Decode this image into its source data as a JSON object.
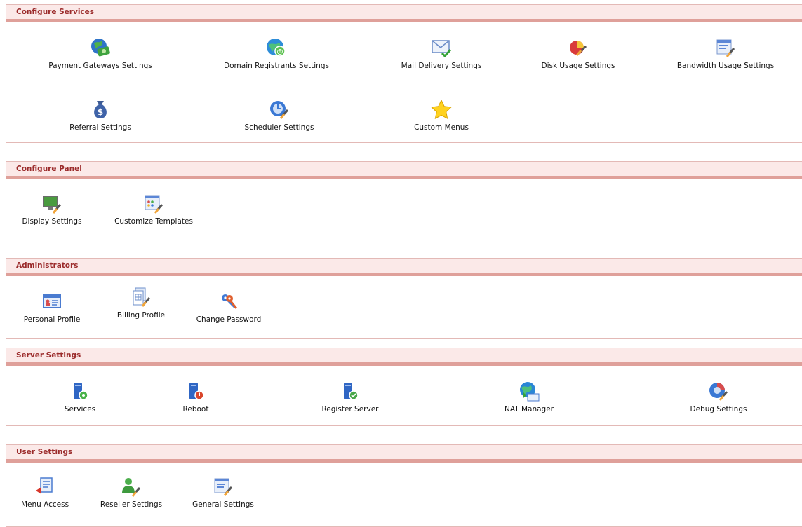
{
  "sections": [
    {
      "title": "Configure Services",
      "items": [
        {
          "label": "Payment Gateways Settings",
          "icon": "payment-gateway-icon"
        },
        {
          "label": "Domain Registrants Settings",
          "icon": "domain-registrant-icon"
        },
        {
          "label": "Mail Delivery Settings",
          "icon": "mail-delivery-icon"
        },
        {
          "label": "Disk Usage Settings",
          "icon": "disk-usage-icon"
        },
        {
          "label": "Bandwidth Usage Settings",
          "icon": "bandwidth-usage-icon"
        },
        {
          "label": "Referral Settings",
          "icon": "referral-moneybag-icon"
        },
        {
          "label": "Scheduler Settings",
          "icon": "scheduler-icon"
        },
        {
          "label": "Custom Menus",
          "icon": "star-icon"
        }
      ]
    },
    {
      "title": "Configure Panel",
      "items": [
        {
          "label": "Display Settings",
          "icon": "display-settings-icon"
        },
        {
          "label": "Customize Templates",
          "icon": "customize-templates-icon"
        }
      ]
    },
    {
      "title": "Administrators",
      "items": [
        {
          "label": "Personal Profile",
          "icon": "personal-profile-icon"
        },
        {
          "label": "Billing Profile",
          "icon": "billing-profile-icon"
        },
        {
          "label": "Change Password",
          "icon": "keys-icon"
        }
      ]
    },
    {
      "title": "Server Settings",
      "items": [
        {
          "label": "Services",
          "icon": "server-services-icon"
        },
        {
          "label": "Reboot",
          "icon": "server-reboot-icon"
        },
        {
          "label": "Register Server",
          "icon": "server-register-icon"
        },
        {
          "label": "NAT Manager",
          "icon": "nat-manager-icon"
        },
        {
          "label": "Debug Settings",
          "icon": "debug-settings-icon"
        }
      ]
    },
    {
      "title": "User Settings",
      "items": [
        {
          "label": "Menu Access",
          "icon": "menu-access-icon"
        },
        {
          "label": "Reseller Settings",
          "icon": "reseller-settings-icon"
        },
        {
          "label": "General Settings",
          "icon": "general-settings-icon"
        }
      ]
    }
  ],
  "colors": {
    "header_bg": "#fbe9e8",
    "header_border": "#dfa09a",
    "header_text": "#9b2b2b"
  }
}
